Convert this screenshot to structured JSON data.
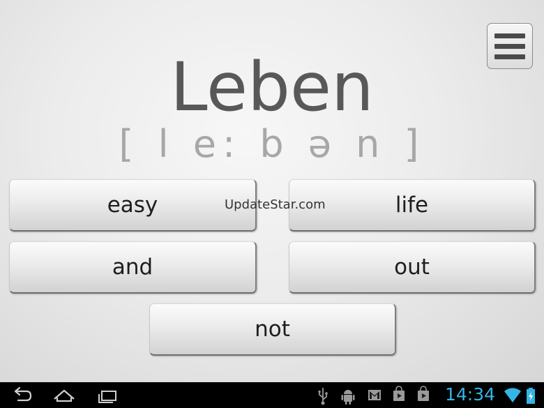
{
  "word": "Leben",
  "pronunciation": "[ l e: b ə n ]",
  "answers": {
    "top_left": "easy",
    "top_right": "life",
    "middle_left": "and",
    "middle_right": "out",
    "bottom": "not"
  },
  "watermark": "UpdateStar.com",
  "status_bar": {
    "time": "14:34"
  },
  "icons": {
    "menu": "menu-icon",
    "back": "back-icon",
    "home": "home-icon",
    "recents": "recent-apps-icon",
    "usb": "usb-icon",
    "android_debug": "android-debug-icon",
    "gmail": "gmail-icon",
    "store_1": "shopping-bag-icon",
    "store_2": "shopping-bag-icon",
    "wifi": "wifi-icon",
    "battery": "battery-icon"
  },
  "colors": {
    "accent": "#33b5e5",
    "word_color": "#585858",
    "ipa_color": "#a7a7a7"
  }
}
